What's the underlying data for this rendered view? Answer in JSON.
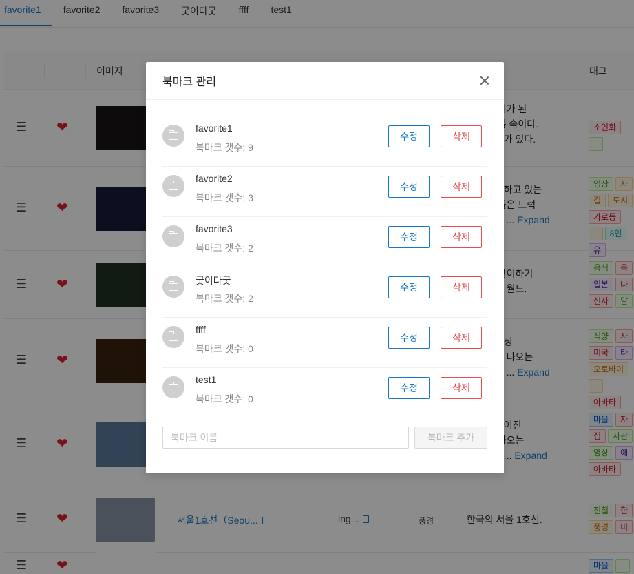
{
  "tabs": [
    "favorite1",
    "favorite2",
    "favorite3",
    "굿이다굿",
    "ffff",
    "test1"
  ],
  "table": {
    "headers": {
      "image": "이미지",
      "tags": "태그"
    },
    "rows": [
      {
        "desc": [
          "은 쥐가 된",
          "벽 틈 속이다.",
          "도구가 있다."
        ],
        "expand": "",
        "tags": [
          [
            "소인화",
            "t-red"
          ],
          [
            "",
            "t-green"
          ]
        ],
        "thumb_color": "#1b1416"
      },
      {
        "desc": [
          "운전하고 있는",
          "그 좁은 트럭",
          "찾아 ..."
        ],
        "expand": "Expand",
        "tags": [
          [
            "영상",
            "t-green"
          ],
          [
            "자",
            "t-orange"
          ],
          [
            "길",
            "t-orange"
          ],
          [
            "도시",
            "t-orange"
          ],
          [
            "가로등",
            "t-red"
          ],
          [
            "",
            "t-orange"
          ],
          [
            "8인",
            "t-cyan"
          ],
          [
            "유",
            "t-purple"
          ]
        ],
        "thumb_color": "#141c3a"
      },
      {
        "desc": [
          "을 맞이하기",
          "만든 월드."
        ],
        "expand": "",
        "tags": [
          [
            "음식",
            "t-green"
          ],
          [
            "음",
            "t-red"
          ],
          [
            "일본",
            "t-purple"
          ],
          [
            "나",
            "t-red"
          ],
          [
            "신사",
            "t-red"
          ],
          [
            "달",
            "t-green"
          ]
        ],
        "thumb_color": "#203220"
      },
      {
        "desc": [
          "라이징",
          "에서 나오는",
          "미국 ..."
        ],
        "expand": "Expand",
        "tags": [
          [
            "석양",
            "t-green"
          ],
          [
            "사",
            "t-red"
          ],
          [
            "미국",
            "t-red"
          ],
          [
            "타",
            "t-purple"
          ],
          [
            "오토바이",
            "t-orange"
          ],
          [
            "",
            "t-orange"
          ],
          [
            "아바타",
            "t-red"
          ]
        ],
        "thumb_color": "#3a2410"
      },
      {
        "desc": [
          "만들어진",
          "에 나오는",
          "아바..."
        ],
        "expand": "Expand",
        "tags": [
          [
            "마을",
            "t-blue"
          ],
          [
            "자",
            "t-red"
          ],
          [
            "집",
            "t-red"
          ],
          [
            "자판",
            "t-green"
          ],
          [
            "영상",
            "t-green"
          ],
          [
            "애",
            "t-purple"
          ],
          [
            "아바타",
            "t-red"
          ]
        ],
        "thumb_color": "#5a7a9a"
      },
      {
        "title": "서울1호선（Seou...",
        "title2": "ing...",
        "category": "풍경",
        "desc": [
          "한국의 서울 1호선."
        ],
        "expand": "",
        "tags": [
          [
            "전철",
            "t-green"
          ],
          [
            "한",
            "t-red"
          ],
          [
            "풍경",
            "t-orange"
          ],
          [
            "비",
            "t-red"
          ]
        ],
        "thumb_color": "#8a96a6"
      },
      {
        "desc": [],
        "expand": "",
        "tags": [
          [
            "마을",
            "t-blue"
          ],
          [
            "",
            "t-green"
          ]
        ],
        "thumb_color": "#fff"
      }
    ]
  },
  "modal": {
    "title": "북마크 관리",
    "count_label": "북마크 갯수: ",
    "edit_label": "수정",
    "delete_label": "삭제",
    "items": [
      {
        "name": "favorite1",
        "count": "9"
      },
      {
        "name": "favorite2",
        "count": "3"
      },
      {
        "name": "favorite3",
        "count": "2"
      },
      {
        "name": "굿이다굿",
        "count": "2"
      },
      {
        "name": "ffff",
        "count": "0"
      },
      {
        "name": "test1",
        "count": "0"
      }
    ],
    "input_placeholder": "북마크 이름",
    "add_label": "북마크 추가"
  }
}
